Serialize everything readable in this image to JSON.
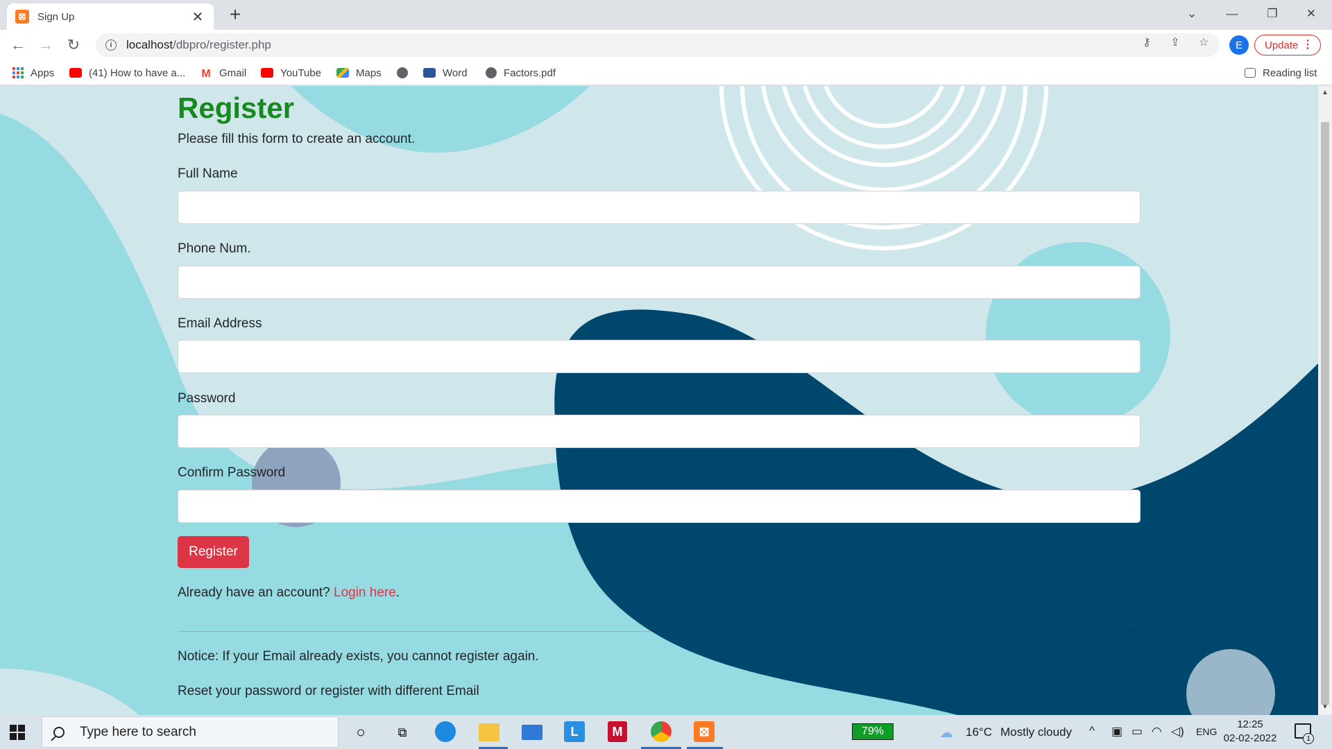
{
  "browser": {
    "tab_title": "Sign Up",
    "url_host": "localhost",
    "url_path": "/dbpro/register.php",
    "update_label": "Update",
    "avatar_letter": "E",
    "reading_list_label": "Reading list",
    "bookmarks": [
      {
        "label": "Apps",
        "icon": "apps-icon"
      },
      {
        "label": "(41) How to have a...",
        "icon": "youtube-icon"
      },
      {
        "label": "Gmail",
        "icon": "gmail-icon"
      },
      {
        "label": "YouTube",
        "icon": "youtube-icon"
      },
      {
        "label": "Maps",
        "icon": "maps-icon"
      },
      {
        "label": "",
        "icon": "globe-icon"
      },
      {
        "label": "Word",
        "icon": "word-icon"
      },
      {
        "label": "Factors.pdf",
        "icon": "globe-icon"
      }
    ]
  },
  "form": {
    "title": "Register",
    "subtitle": "Please fill this form to create an account.",
    "fields": [
      {
        "label": "Full Name",
        "value": ""
      },
      {
        "label": "Phone Num.",
        "value": ""
      },
      {
        "label": "Email Address",
        "value": ""
      },
      {
        "label": "Password",
        "value": ""
      },
      {
        "label": "Confirm Password",
        "value": ""
      }
    ],
    "submit_label": "Register",
    "account_prompt": "Already have an account?",
    "login_link": "Login here",
    "login_suffix": ".",
    "notice": "Notice: If your Email already exists, you cannot register again.",
    "reset_text": "Reset your password or register with different Email"
  },
  "taskbar": {
    "search_placeholder": "Type here to search",
    "battery": "79%",
    "weather_temp": "16°C",
    "weather_desc": "Mostly cloudy",
    "language": "ENG",
    "time": "12:25",
    "date": "02-02-2022",
    "notification_count": "1"
  },
  "colors": {
    "page_bg": "#cfe7ea",
    "wave_light": "#97dbe2",
    "wave_dark": "#00476e",
    "title_green": "#178a1f",
    "button_red": "#dc3545"
  }
}
